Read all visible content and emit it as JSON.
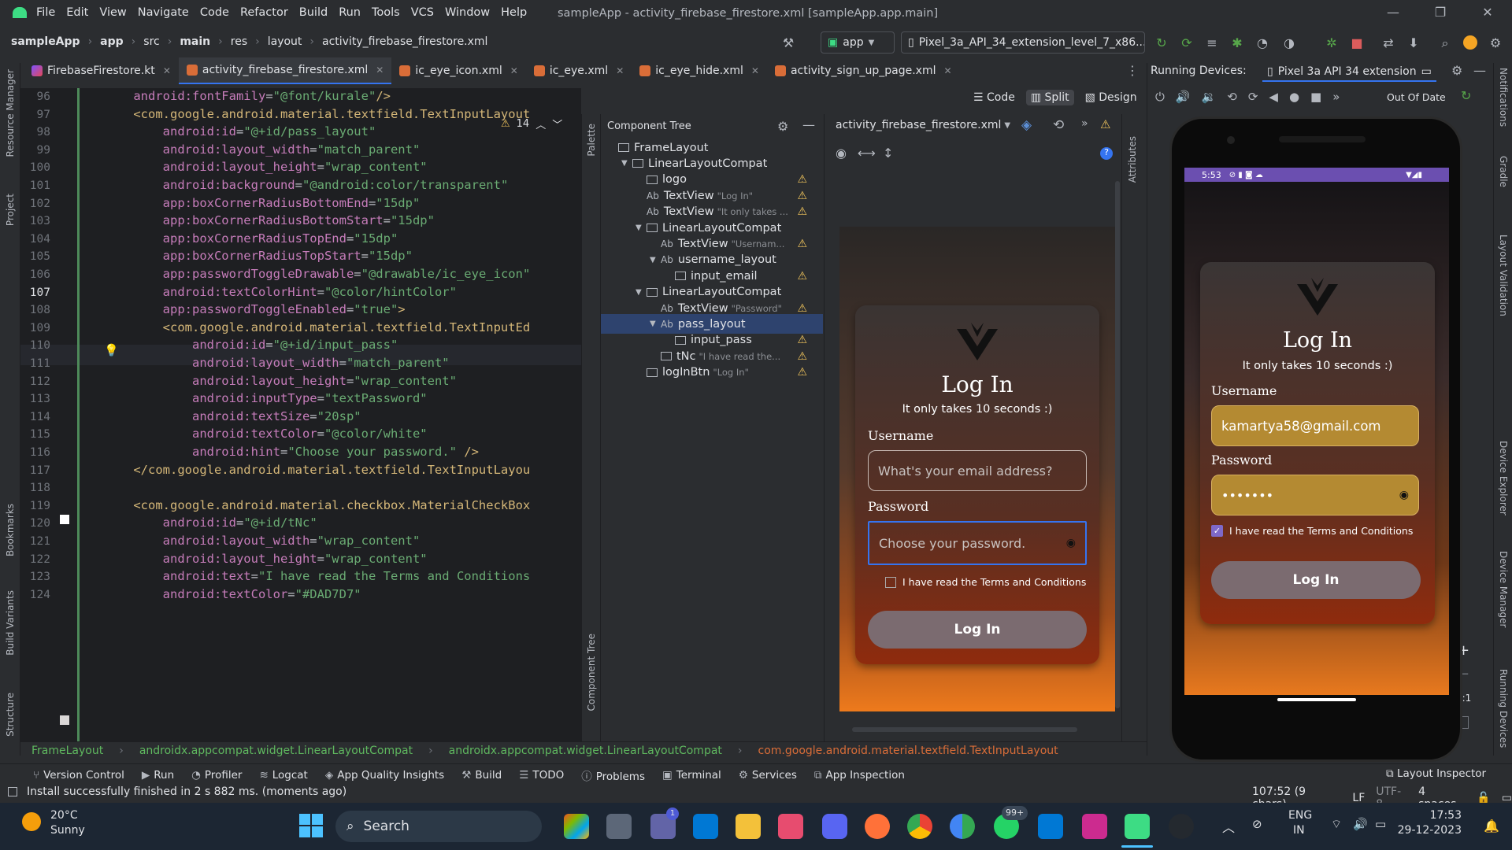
{
  "titlebar": {
    "menu": [
      "File",
      "Edit",
      "View",
      "Navigate",
      "Code",
      "Refactor",
      "Build",
      "Run",
      "Tools",
      "VCS",
      "Window",
      "Help"
    ],
    "title": "sampleApp - activity_firebase_firestore.xml [sampleApp.app.main]"
  },
  "navbar": {
    "breadcrumbs": [
      "sampleApp",
      "app",
      "src",
      "main",
      "res",
      "layout",
      "activity_firebase_firestore.xml"
    ],
    "run_config": "app",
    "device": "Pixel_3a_API_34_extension_level_7_x86..."
  },
  "tabs": [
    {
      "label": "FirebaseFirestore.kt",
      "active": false
    },
    {
      "label": "activity_firebase_firestore.xml",
      "active": true
    },
    {
      "label": "ic_eye_icon.xml",
      "active": false
    },
    {
      "label": "ic_eye.xml",
      "active": false
    },
    {
      "label": "ic_eye_hide.xml",
      "active": false
    },
    {
      "label": "activity_sign_up_page.xml",
      "active": false
    }
  ],
  "view_modes": {
    "code": "Code",
    "split": "Split",
    "design": "Design"
  },
  "editor": {
    "warnings": "14",
    "lines": [
      {
        "n": "96",
        "text": "    android:fontFamily=\"@font/kurale\"/>"
      },
      {
        "n": "97",
        "text": "    <com.google.android.material.textfield.TextInputLayout"
      },
      {
        "n": "98",
        "text": "        android:id=\"@+id/pass_layout\""
      },
      {
        "n": "99",
        "text": "        android:layout_width=\"match_parent\""
      },
      {
        "n": "100",
        "text": "        android:layout_height=\"wrap_content\""
      },
      {
        "n": "101",
        "text": "        android:background=\"@android:color/transparent\""
      },
      {
        "n": "102",
        "text": "        app:boxCornerRadiusBottomEnd=\"15dp\""
      },
      {
        "n": "103",
        "text": "        app:boxCornerRadiusBottomStart=\"15dp\""
      },
      {
        "n": "104",
        "text": "        app:boxCornerRadiusTopEnd=\"15dp\""
      },
      {
        "n": "105",
        "text": "        app:boxCornerRadiusTopStart=\"15dp\""
      },
      {
        "n": "106",
        "text": "        app:passwordToggleDrawable=\"@drawable/ic_eye_icon\""
      },
      {
        "n": "107",
        "text": "        android:textColorHint=\"@color/hintColor\""
      },
      {
        "n": "108",
        "text": "        app:passwordToggleEnabled=\"true\">"
      },
      {
        "n": "109",
        "text": "        <com.google.android.material.textfield.TextInputEd"
      },
      {
        "n": "110",
        "text": "            android:id=\"@+id/input_pass\""
      },
      {
        "n": "111",
        "text": "            android:layout_width=\"match_parent\""
      },
      {
        "n": "112",
        "text": "            android:layout_height=\"wrap_content\""
      },
      {
        "n": "113",
        "text": "            android:inputType=\"textPassword\""
      },
      {
        "n": "114",
        "text": "            android:textSize=\"20sp\""
      },
      {
        "n": "115",
        "text": "            android:textColor=\"@color/white\""
      },
      {
        "n": "116",
        "text": "            android:hint=\"Choose your password.\" />"
      },
      {
        "n": "117",
        "text": "    </com.google.android.material.textfield.TextInputLayou"
      },
      {
        "n": "118",
        "text": ""
      },
      {
        "n": "119",
        "text": "    <com.google.android.material.checkbox.MaterialCheckBox"
      },
      {
        "n": "120",
        "text": "        android:id=\"@+id/tNc\""
      },
      {
        "n": "121",
        "text": "        android:layout_width=\"wrap_content\""
      },
      {
        "n": "122",
        "text": "        android:layout_height=\"wrap_content\""
      },
      {
        "n": "123",
        "text": "        android:text=\"I have read the Terms and Conditions"
      },
      {
        "n": "124",
        "text": "        android:textColor=\"#DAD7D7\""
      }
    ]
  },
  "side_labels": {
    "left": [
      "Resource Manager",
      "Project",
      "Bookmarks",
      "Build Variants",
      "Structure"
    ],
    "palette": "Palette",
    "component_tree_vertical": "Component Tree",
    "attributes": "Attributes",
    "right": [
      "Notifications",
      "Gradle",
      "Layout Validation",
      "Device Explorer",
      "Device Manager",
      "Running Devices"
    ]
  },
  "component_tree": {
    "title": "Component Tree",
    "items": [
      {
        "label": "FrameLayout",
        "hint": "",
        "warn": false
      },
      {
        "label": "LinearLayoutCompat",
        "hint": "",
        "warn": false
      },
      {
        "label": "logo",
        "hint": "",
        "warn": true
      },
      {
        "label": "TextView",
        "hint": "\"Log In\"",
        "warn": true
      },
      {
        "label": "TextView",
        "hint": "\"It only takes ...",
        "warn": true
      },
      {
        "label": "LinearLayoutCompat",
        "hint": "",
        "warn": false
      },
      {
        "label": "TextView",
        "hint": "\"Usernam...",
        "warn": true
      },
      {
        "label": "username_layout",
        "hint": "",
        "warn": false
      },
      {
        "label": "input_email",
        "hint": "",
        "warn": true
      },
      {
        "label": "LinearLayoutCompat",
        "hint": "",
        "warn": false
      },
      {
        "label": "TextView",
        "hint": "\"Password\"",
        "warn": true
      },
      {
        "label": "pass_layout",
        "hint": "",
        "warn": false
      },
      {
        "label": "input_pass",
        "hint": "",
        "warn": true
      },
      {
        "label": "tNc",
        "hint": "\"I have read the...",
        "warn": true
      },
      {
        "label": "logInBtn",
        "hint": "\"Log In\"",
        "warn": true
      }
    ]
  },
  "designer": {
    "file_dropdown": "activity_firebase_firestore.xml"
  },
  "preview": {
    "title": "Log In",
    "subtitle": "It only takes 10 seconds :)",
    "username_label": "Username",
    "username_placeholder": "What's your email address?",
    "password_label": "Password",
    "password_placeholder": "Choose your password.",
    "terms": "I have read the Terms and Conditions",
    "login_button": "Log In"
  },
  "running_devices": {
    "label": "Running Devices:",
    "device_tab": "Pixel 3a API 34 extension",
    "out_of_date": "Out Of Date",
    "zoom_ratio": "1:1"
  },
  "emulator": {
    "time": "5:53",
    "title": "Log In",
    "subtitle": "It only takes 10 seconds :)",
    "username_label": "Username",
    "username_value": "kamartya58@gmail.com",
    "password_label": "Password",
    "password_value": "•••••••",
    "terms": "I have read the Terms and Conditions",
    "login_button": "Log In"
  },
  "crumb_path": [
    "FrameLayout",
    "androidx.appcompat.widget.LinearLayoutCompat",
    "androidx.appcompat.widget.LinearLayoutCompat",
    "com.google.android.material.textfield.TextInputLayout"
  ],
  "bottom_tools": [
    "Version Control",
    "Run",
    "Profiler",
    "Logcat",
    "App Quality Insights",
    "Build",
    "TODO",
    "Problems",
    "Terminal",
    "Services",
    "App Inspection"
  ],
  "layout_inspector": "Layout Inspector",
  "status": {
    "message": "Install successfully finished in 2 s 882 ms. (moments ago)",
    "position": "107:52 (9 chars)",
    "line_sep": "LF",
    "encoding": "UTF-8",
    "indent": "4 spaces"
  },
  "taskbar": {
    "temp": "20°C",
    "weather": "Sunny",
    "search": "Search",
    "badge_whatsapp": "99+",
    "badge_teams": "1",
    "lang": "ENG",
    "region": "IN",
    "time": "17:53",
    "date": "29-12-2023"
  }
}
